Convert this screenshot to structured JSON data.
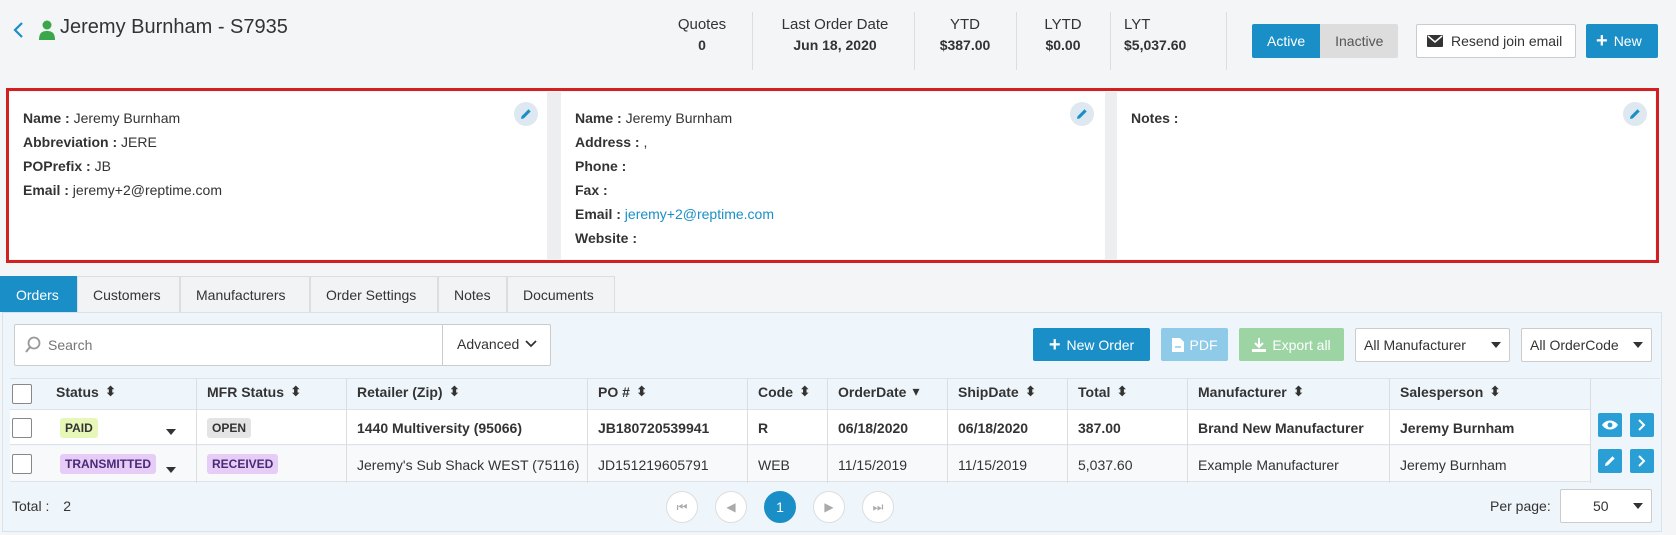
{
  "header": {
    "title": "Jeremy Burnham - S7935",
    "stats": [
      {
        "label": "Quotes",
        "value": "0"
      },
      {
        "label": "Last Order Date",
        "value": "Jun 18, 2020"
      },
      {
        "label": "YTD",
        "value": "$387.00"
      },
      {
        "label": "LYTD",
        "value": "$0.00"
      },
      {
        "label": "LYT",
        "value": "$5,037.60"
      }
    ],
    "status_toggle": {
      "active": "Active",
      "inactive": "Inactive"
    },
    "resend_label": "Resend join email",
    "new_label": "New"
  },
  "panels": {
    "account": {
      "name_label": "Name :",
      "name": "Jeremy Burnham",
      "abbr_label": "Abbreviation :",
      "abbr": "JERE",
      "poprefix_label": "POPrefix :",
      "poprefix": "JB",
      "email_label": "Email :",
      "email": "jeremy+2@reptime.com"
    },
    "contact": {
      "name_label": "Name :",
      "name": "Jeremy Burnham",
      "address_label": "Address :",
      "address": ",",
      "phone_label": "Phone :",
      "fax_label": "Fax :",
      "email_label": "Email :",
      "email": "jeremy+2@reptime.com",
      "website_label": "Website :"
    },
    "notes": {
      "label": "Notes :"
    }
  },
  "tabs": [
    "Orders",
    "Customers",
    "Manufacturers",
    "Order Settings",
    "Notes",
    "Documents"
  ],
  "toolbar": {
    "search_placeholder": "Search",
    "advanced_label": "Advanced",
    "new_order_label": "New Order",
    "pdf_label": "PDF",
    "export_label": "Export all",
    "manufacturer_filter": "All Manufacturer",
    "ordercode_filter": "All OrderCode"
  },
  "table": {
    "columns": [
      "Status",
      "MFR Status",
      "Retailer (Zip)",
      "PO #",
      "Code",
      "OrderDate",
      "ShipDate",
      "Total",
      "Manufacturer",
      "Salesperson"
    ],
    "rows": [
      {
        "status": "PAID",
        "mfr_status": "OPEN",
        "retailer": "1440 Multiversity (95066)",
        "po": "JB180720539941",
        "code": "R",
        "order_date": "06/18/2020",
        "ship_date": "06/18/2020",
        "total": "387.00",
        "manufacturer": "Brand New Manufacturer",
        "salesperson": "Jeremy Burnham"
      },
      {
        "status": "TRANSMITTED",
        "mfr_status": "RECEIVED",
        "retailer": "Jeremy's Sub Shack WEST (75116)",
        "po": "JD151219605791",
        "code": "WEB",
        "order_date": "11/15/2019",
        "ship_date": "11/15/2019",
        "total": "5,037.60",
        "manufacturer": "Example Manufacturer",
        "salesperson": "Jeremy Burnham"
      }
    ]
  },
  "footer": {
    "total_label": "Total :",
    "total_value": "2",
    "current_page": "1",
    "per_page_label": "Per page:",
    "per_page_value": "50"
  },
  "colors": {
    "accent": "#1a8fc7",
    "highlight": "#d21f1f",
    "paid": "#e6f7b8",
    "transmitted": "#e6cdf7"
  }
}
